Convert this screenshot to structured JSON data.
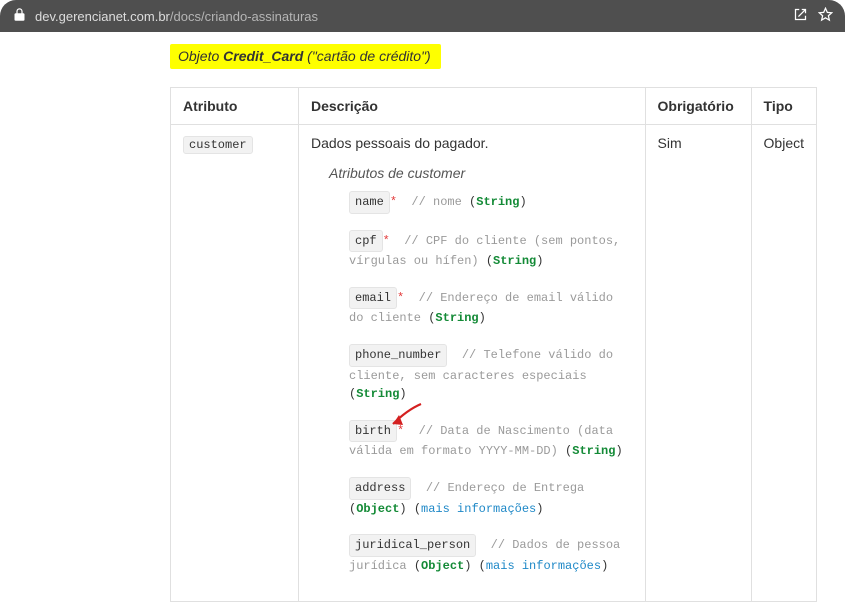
{
  "addressbar": {
    "host": "dev.gerencianet.com.br",
    "path": "/docs/criando-assinaturas"
  },
  "highlight": {
    "prefix": "Objeto ",
    "bold": "Credit_Card",
    "suffix": " (\"cartão de crédito\")"
  },
  "table": {
    "headers": {
      "c1": "Atributo",
      "c2": "Descrição",
      "c3": "Obrigatório",
      "c4": "Tipo"
    },
    "row": {
      "attr": "customer",
      "desc_lead": "Dados pessoais do pagador.",
      "subheading": "Atributos de customer",
      "obrg": "Sim",
      "tipo": "Object"
    }
  },
  "attrs": {
    "name": {
      "chip": "name",
      "required": "*",
      "slashes": "// ",
      "comment": "nome ",
      "type": "String"
    },
    "cpf": {
      "chip": "cpf",
      "required": "*",
      "slashes": "// ",
      "comment": "CPF do cliente (sem pontos, vírgulas ou hífen) ",
      "type": "String"
    },
    "email": {
      "chip": "email",
      "required": "*",
      "slashes": "// ",
      "comment": "Endereço de email válido do cliente ",
      "type": "String"
    },
    "phone": {
      "chip": "phone_number",
      "required": "",
      "slashes": "// ",
      "comment": "Telefone válido do cliente, sem caracteres especiais ",
      "type": "String"
    },
    "birth": {
      "chip": "birth",
      "required": "*",
      "slashes": "// ",
      "comment": "Data de Nascimento (data válida em formato YYYY-MM-DD) ",
      "type": "String"
    },
    "address": {
      "chip": "address",
      "required": "",
      "slashes": "// ",
      "comment": "Endereço de Entrega ",
      "type": "Object",
      "link": "mais informações"
    },
    "juridical": {
      "chip": "juridical_person",
      "required": "",
      "slashes": "// ",
      "comment": "Dados de pessoa jurídica ",
      "type": "Object",
      "link": "mais informações"
    }
  }
}
